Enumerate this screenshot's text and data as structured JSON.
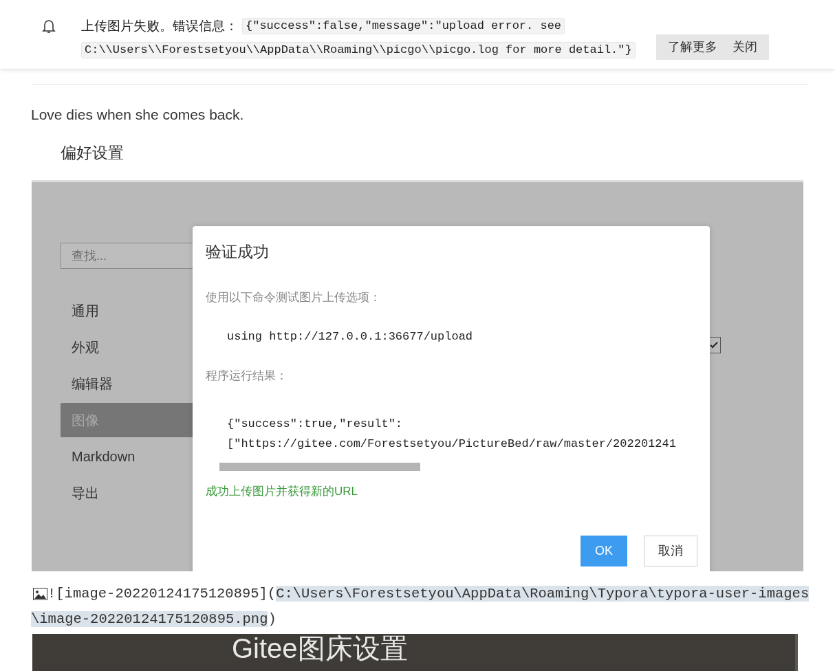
{
  "notification": {
    "message": "上传图片失败。错误信息：",
    "detail_lines": [
      "{\"success\":false,\"message\":\"upload error. see",
      "C:\\\\Users\\\\Forestsetyou\\\\AppData\\\\Roaming\\\\picgo\\\\picgo.log for more detail.\"}"
    ],
    "buttons": [
      "了解更多",
      "关闭"
    ]
  },
  "paragraph": "Love dies when she comes back.",
  "subheading": "偏好设置",
  "screenshot": {
    "search": {
      "placeholder": "查找..."
    },
    "sidebar": {
      "items": [
        {
          "label": "通用",
          "selected": false
        },
        {
          "label": "外观",
          "selected": false
        },
        {
          "label": "编辑器",
          "selected": false
        },
        {
          "label": "图像",
          "selected": true
        },
        {
          "label": "Markdown",
          "selected": false
        },
        {
          "label": "导出",
          "selected": false
        }
      ]
    },
    "checkbox": {
      "checked": true
    },
    "dialog": {
      "title": "验证成功",
      "command_label": "使用以下命令测试图片上传选项：",
      "command": "using http://127.0.0.1:36677/upload",
      "result_label": "程序运行结果：",
      "result_lines": [
        "{\"success\":true,\"result\":",
        "[\"https://gitee.com/Forestsetyou/PictureBed/raw/master/202201241"
      ],
      "success_message": "成功上传图片并获得新的URL",
      "buttons": [
        {
          "label": "OK",
          "kind": "primary"
        },
        {
          "label": "取消",
          "kind": "secondary"
        }
      ]
    }
  },
  "markdown_line": {
    "prefix": "![image-20220124175120895](",
    "selected_text": "C:\\Users\\Forestsetyou\\AppData\\Roaming\\Typora\\typora-user-images\\image-20220124175120895.png",
    "suffix": ")"
  },
  "next_image": {
    "caption": "Gitee图床设置"
  }
}
